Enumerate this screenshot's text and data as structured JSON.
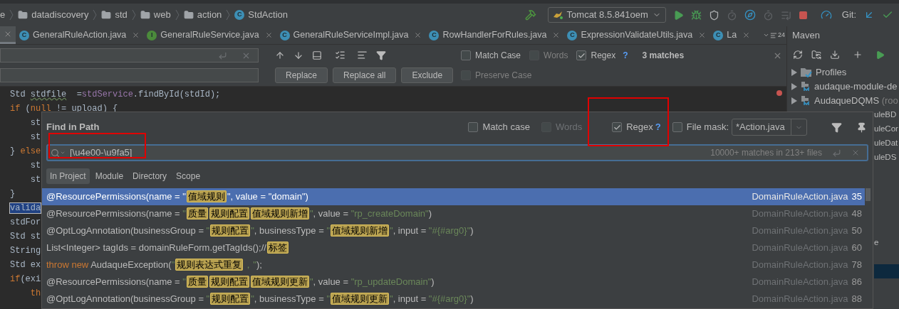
{
  "breadcrumb": [
    {
      "kind": "text",
      "label": "e"
    },
    {
      "kind": "folder",
      "label": "datadiscovery"
    },
    {
      "kind": "folder",
      "label": "std"
    },
    {
      "kind": "folder",
      "label": "web"
    },
    {
      "kind": "folder",
      "label": "action"
    },
    {
      "kind": "class",
      "badge": "C",
      "label": "StdAction"
    }
  ],
  "run_config": "Tomcat 8.5.841oem",
  "git_label": "Git:",
  "tabs": [
    {
      "kind": "cut",
      "selected": true
    },
    {
      "kind": "file",
      "badge": "C",
      "label": "GeneralRuleAction.java",
      "selected": false
    },
    {
      "kind": "file",
      "badge": "I",
      "label": "GeneralRuleService.java",
      "selected": false
    },
    {
      "kind": "file",
      "badge": "C",
      "label": "GeneralRuleServiceImpl.java",
      "selected": false
    },
    {
      "kind": "file",
      "badge": "C",
      "label": "RowHandlerForRules.java",
      "selected": false
    },
    {
      "kind": "file",
      "badge": "C",
      "label": "ExpressionValidateUtils.java",
      "selected": false
    },
    {
      "kind": "file",
      "badge": "C",
      "label": "La",
      "selected": false
    }
  ],
  "tab_overflow": "24",
  "find_bar": {
    "options": [
      {
        "label": "Match Case",
        "checked": false
      },
      {
        "label": "Words",
        "checked": false
      },
      {
        "label": "Regex",
        "checked": true,
        "help": "?"
      }
    ],
    "match_count": "3 matches",
    "buttons": [
      "Replace",
      "Replace all",
      "Exclude"
    ],
    "preserve_case": {
      "label": "Preserve Case",
      "checked": false
    }
  },
  "editor_lines": [
    [
      {
        "kind": "plain",
        "text": "Std "
      },
      {
        "kind": "warn",
        "text": "stdfile"
      },
      {
        "kind": "plain",
        "text": "  ="
      },
      {
        "kind": "field",
        "text": "stdService"
      },
      {
        "kind": "plain",
        "text": ".findById(stdId);"
      }
    ],
    [
      {
        "kind": "keyword",
        "text": "if"
      },
      {
        "kind": "plain",
        "text": " ("
      },
      {
        "kind": "keyword",
        "text": "null"
      },
      {
        "kind": "plain",
        "text": " != upload) {"
      }
    ],
    [
      {
        "kind": "plain",
        "text": "    st"
      }
    ],
    [
      {
        "kind": "plain",
        "text": "    st"
      }
    ],
    [
      {
        "kind": "plain",
        "text": "} "
      },
      {
        "kind": "keyword",
        "text": "else"
      }
    ],
    [
      {
        "kind": "plain",
        "text": "    st"
      }
    ],
    [
      {
        "kind": "plain",
        "text": "    st"
      }
    ],
    [
      {
        "kind": "plain",
        "text": "}"
      }
    ],
    [
      {
        "kind": "selected",
        "text": "valida"
      }
    ],
    [
      {
        "kind": "plain",
        "text": "stdFor"
      }
    ],
    [
      {
        "kind": "plain",
        "text": "Std st"
      }
    ],
    [
      {
        "kind": "plain",
        "text": "String"
      }
    ],
    [
      {
        "kind": "plain",
        "text": "Std ex"
      }
    ],
    [
      {
        "kind": "keyword",
        "text": "if"
      },
      {
        "kind": "plain",
        "text": "(exi"
      }
    ],
    [
      {
        "kind": "keyword",
        "text": "    th"
      }
    ]
  ],
  "find_dialog": {
    "title": "Find in Path",
    "options": [
      {
        "label": "Match case",
        "checked": false,
        "disabled": false
      },
      {
        "label": "Words",
        "checked": false,
        "disabled": true
      },
      {
        "label": "Regex",
        "checked": true,
        "disabled": false,
        "help": "?"
      },
      {
        "label": "File mask:",
        "checked": false,
        "disabled": false
      }
    ],
    "file_mask": "*Action.java",
    "query": "[\\u4e00-\\u9fa5]",
    "match_summary": "10000+ matches in 213+ files",
    "scopes": [
      {
        "label": "In Project",
        "selected": true
      },
      {
        "label": "Module",
        "selected": false
      },
      {
        "label": "Directory",
        "selected": false
      },
      {
        "label": "Scope",
        "selected": false
      }
    ],
    "results": [
      {
        "selected": true,
        "file": "DomainRuleAction.java",
        "line": "35",
        "segments": [
          {
            "kind": "plain",
            "text": "@ResourcePermissions(name = "
          },
          {
            "kind": "string",
            "text": "\""
          },
          {
            "kind": "match",
            "text": "值域规则"
          },
          {
            "kind": "string",
            "text": "\""
          },
          {
            "kind": "plain",
            "text": ", value = "
          },
          {
            "kind": "string",
            "text": "\"domain\""
          },
          {
            "kind": "plain",
            "text": ")"
          }
        ]
      },
      {
        "selected": false,
        "file": "DomainRuleAction.java",
        "line": "48",
        "segments": [
          {
            "kind": "plain",
            "text": "@ResourcePermissions(name = "
          },
          {
            "kind": "string",
            "text": "\""
          },
          {
            "kind": "match",
            "text": "质量"
          },
          {
            "kind": "match",
            "text": "规则配置"
          },
          {
            "kind": "match",
            "text": "值域规则新增"
          },
          {
            "kind": "string",
            "text": "\""
          },
          {
            "kind": "plain",
            "text": ", value = "
          },
          {
            "kind": "string",
            "text": "\"rp_createDomain\""
          },
          {
            "kind": "plain",
            "text": ")"
          }
        ]
      },
      {
        "selected": false,
        "file": "DomainRuleAction.java",
        "line": "50",
        "segments": [
          {
            "kind": "plain",
            "text": "@OptLogAnnotation(businessGroup = "
          },
          {
            "kind": "string",
            "text": "\""
          },
          {
            "kind": "match",
            "text": "规则配置"
          },
          {
            "kind": "string",
            "text": "\""
          },
          {
            "kind": "plain",
            "text": ", businessType = "
          },
          {
            "kind": "string",
            "text": "\""
          },
          {
            "kind": "match",
            "text": "值域规则新增"
          },
          {
            "kind": "string",
            "text": "\""
          },
          {
            "kind": "plain",
            "text": ", input = "
          },
          {
            "kind": "string",
            "text": "\"#{#arg0}\""
          },
          {
            "kind": "plain",
            "text": ")"
          }
        ]
      },
      {
        "selected": false,
        "file": "DomainRuleAction.java",
        "line": "60",
        "segments": [
          {
            "kind": "plain",
            "text": "List<Integer> tagIds = domainRuleForm.getTagIds();//"
          },
          {
            "kind": "match",
            "text": "标签"
          }
        ]
      },
      {
        "selected": false,
        "file": "DomainRuleAction.java",
        "line": "78",
        "segments": [
          {
            "kind": "keyword",
            "text": "throw new "
          },
          {
            "kind": "plain",
            "text": "AudaqueException("
          },
          {
            "kind": "string",
            "text": "\""
          },
          {
            "kind": "match",
            "text": "规则表达式重复"
          },
          {
            "kind": "string",
            "text": "，\""
          },
          {
            "kind": "plain",
            "text": ");"
          }
        ]
      },
      {
        "selected": false,
        "file": "DomainRuleAction.java",
        "line": "86",
        "segments": [
          {
            "kind": "plain",
            "text": "@ResourcePermissions(name = "
          },
          {
            "kind": "string",
            "text": "\""
          },
          {
            "kind": "match",
            "text": "质量"
          },
          {
            "kind": "match",
            "text": "规则配置"
          },
          {
            "kind": "match",
            "text": "值域规则更新"
          },
          {
            "kind": "string",
            "text": "\""
          },
          {
            "kind": "plain",
            "text": ", value = "
          },
          {
            "kind": "string",
            "text": "\"rp_updateDomain\""
          },
          {
            "kind": "plain",
            "text": ")"
          }
        ]
      },
      {
        "selected": false,
        "file": "DomainRuleAction.java",
        "line": "88",
        "segments": [
          {
            "kind": "plain",
            "text": "@OptLogAnnotation(businessGroup = "
          },
          {
            "kind": "string",
            "text": "\""
          },
          {
            "kind": "match",
            "text": "规则配置"
          },
          {
            "kind": "string",
            "text": "\""
          },
          {
            "kind": "plain",
            "text": ", businessType = "
          },
          {
            "kind": "string",
            "text": "\""
          },
          {
            "kind": "match",
            "text": "值域规则更新"
          },
          {
            "kind": "string",
            "text": "\""
          },
          {
            "kind": "plain",
            "text": ", input = "
          },
          {
            "kind": "string",
            "text": "\"#{#arg0}\""
          },
          {
            "kind": "plain",
            "text": ")"
          }
        ]
      }
    ]
  },
  "maven": {
    "title": "Maven",
    "tree": [
      {
        "kind": "profiles",
        "label": "Profiles",
        "selected": false
      },
      {
        "kind": "module",
        "label": "audaque-module-de",
        "selected": false
      },
      {
        "kind": "module",
        "label": "AudaqueDQMS",
        "suffix": "(roo",
        "selected": false
      },
      {
        "kind": "clipped",
        "label": "uleBD",
        "selected": false
      },
      {
        "kind": "clipped",
        "label": "uleCor",
        "selected": false
      },
      {
        "kind": "clipped",
        "label": "uleDat",
        "selected": false
      },
      {
        "kind": "clipped",
        "label": "uleDS",
        "selected": false
      },
      {
        "kind": "hidden"
      },
      {
        "kind": "hidden"
      },
      {
        "kind": "hidden"
      },
      {
        "kind": "hidden"
      },
      {
        "kind": "hidden"
      },
      {
        "kind": "clipped",
        "label": "e",
        "selected": false
      },
      {
        "kind": "hidden"
      },
      {
        "kind": "hidden",
        "selected": true
      }
    ]
  },
  "annotations": [
    {
      "kind": "red-box"
    },
    {
      "kind": "red-box"
    }
  ]
}
